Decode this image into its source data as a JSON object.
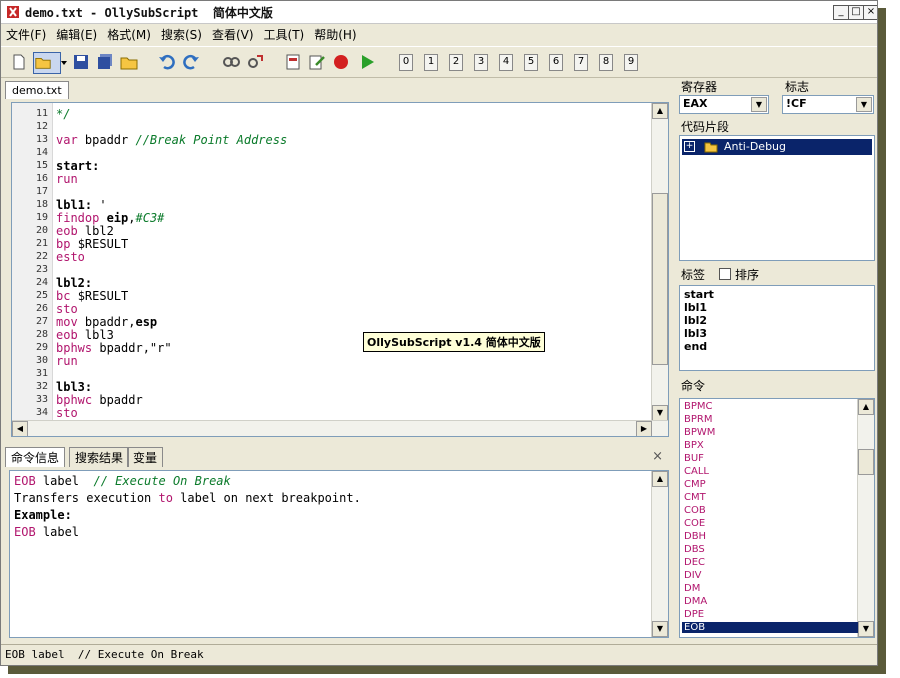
{
  "window": {
    "title": "demo.txt - OllySubScript  简体中文版",
    "btn_min": "_",
    "btn_max": "□",
    "btn_close": "×"
  },
  "menu": [
    "文件(F)",
    "编辑(E)",
    "格式(M)",
    "搜索(S)",
    "查看(V)",
    "工具(T)",
    "帮助(H)"
  ],
  "toolbar": {
    "numbers": [
      "0",
      "1",
      "2",
      "3",
      "4",
      "5",
      "6",
      "7",
      "8",
      "9"
    ]
  },
  "editor": {
    "tab": "demo.txt",
    "tooltip": "OllySubScript v1.4 简体中文版",
    "lines": [
      {
        "n": "11",
        "parts": [
          {
            "t": "*/",
            "c": "cmt"
          }
        ]
      },
      {
        "n": "12",
        "parts": []
      },
      {
        "n": "13",
        "parts": [
          {
            "t": "var ",
            "c": "kw"
          },
          {
            "t": "bpaddr ",
            "c": "plain"
          },
          {
            "t": "//Break Point Address",
            "c": "cmt"
          }
        ]
      },
      {
        "n": "14",
        "parts": []
      },
      {
        "n": "15",
        "parts": [
          {
            "t": "start:",
            "c": "lbl"
          }
        ]
      },
      {
        "n": "16",
        "parts": [
          {
            "t": "run",
            "c": "kw"
          }
        ]
      },
      {
        "n": "17",
        "parts": []
      },
      {
        "n": "18",
        "parts": [
          {
            "t": "lbl1:",
            "c": "lbl"
          },
          {
            "t": " '",
            "c": "plain"
          }
        ]
      },
      {
        "n": "19",
        "parts": [
          {
            "t": "findop ",
            "c": "kw"
          },
          {
            "t": "eip",
            "c": "lbl"
          },
          {
            "t": ",",
            "c": "plain"
          },
          {
            "t": "#C3#",
            "c": "cmt"
          }
        ]
      },
      {
        "n": "20",
        "parts": [
          {
            "t": "eob ",
            "c": "kw"
          },
          {
            "t": "lbl2",
            "c": "plain"
          }
        ]
      },
      {
        "n": "21",
        "parts": [
          {
            "t": "bp ",
            "c": "kw"
          },
          {
            "t": "$RESULT",
            "c": "plain"
          }
        ]
      },
      {
        "n": "22",
        "parts": [
          {
            "t": "esto",
            "c": "kw"
          }
        ]
      },
      {
        "n": "23",
        "parts": []
      },
      {
        "n": "24",
        "parts": [
          {
            "t": "lbl2:",
            "c": "lbl"
          }
        ]
      },
      {
        "n": "25",
        "parts": [
          {
            "t": "bc ",
            "c": "kw"
          },
          {
            "t": "$RESULT",
            "c": "plain"
          }
        ]
      },
      {
        "n": "26",
        "parts": [
          {
            "t": "sto",
            "c": "kw"
          }
        ]
      },
      {
        "n": "27",
        "parts": [
          {
            "t": "mov ",
            "c": "kw"
          },
          {
            "t": "bpaddr,",
            "c": "plain"
          },
          {
            "t": "esp",
            "c": "lbl"
          }
        ]
      },
      {
        "n": "28",
        "parts": [
          {
            "t": "eob ",
            "c": "kw"
          },
          {
            "t": "lbl3",
            "c": "plain"
          }
        ]
      },
      {
        "n": "29",
        "parts": [
          {
            "t": "bphws ",
            "c": "kw"
          },
          {
            "t": "bpaddr,\"r\"",
            "c": "plain"
          }
        ]
      },
      {
        "n": "30",
        "parts": [
          {
            "t": "run",
            "c": "kw"
          }
        ]
      },
      {
        "n": "31",
        "parts": []
      },
      {
        "n": "32",
        "parts": [
          {
            "t": "lbl3:",
            "c": "lbl"
          }
        ]
      },
      {
        "n": "33",
        "parts": [
          {
            "t": "bphwc ",
            "c": "kw"
          },
          {
            "t": "bpaddr",
            "c": "plain"
          }
        ]
      },
      {
        "n": "34",
        "parts": [
          {
            "t": "sto",
            "c": "kw"
          }
        ]
      }
    ]
  },
  "bottom": {
    "tabs": [
      "命令信息",
      "搜索结果",
      "变量"
    ],
    "close": "×",
    "lines": [
      [
        {
          "t": "EOB ",
          "c": "kw"
        },
        {
          "t": "label  ",
          "c": "plain"
        },
        {
          "t": "// Execute On Break",
          "c": "cmt"
        }
      ],
      [
        {
          "t": "Transfers execution ",
          "c": "plain"
        },
        {
          "t": "to",
          "c": "kw"
        },
        {
          "t": " label on next breakpoint.",
          "c": "plain"
        }
      ],
      [
        {
          "t": "Example:",
          "c": "lbl"
        }
      ],
      [
        {
          "t": "EOB ",
          "c": "kw"
        },
        {
          "t": "label",
          "c": "plain"
        }
      ]
    ]
  },
  "status": "EOB label  // Execute On Break",
  "right": {
    "registers_label": "寄存器",
    "register_value": "EAX",
    "flags_label": "标志",
    "flag_value": "!CF",
    "snippets_label": "代码片段",
    "snippet_item": "Anti-Debug",
    "labels_label": "标签",
    "sort_label": "排序",
    "labels": [
      "start",
      "lbl1",
      "lbl2",
      "lbl3",
      "end"
    ],
    "commands_label": "命令",
    "commands": [
      "BPMC",
      "BPRM",
      "BPWM",
      "BPX",
      "BUF",
      "CALL",
      "CMP",
      "CMT",
      "COB",
      "COE",
      "DBH",
      "DBS",
      "DEC",
      "DIV",
      "DM",
      "DMA",
      "DPE",
      "EOB"
    ],
    "selected_command": "EOB"
  }
}
